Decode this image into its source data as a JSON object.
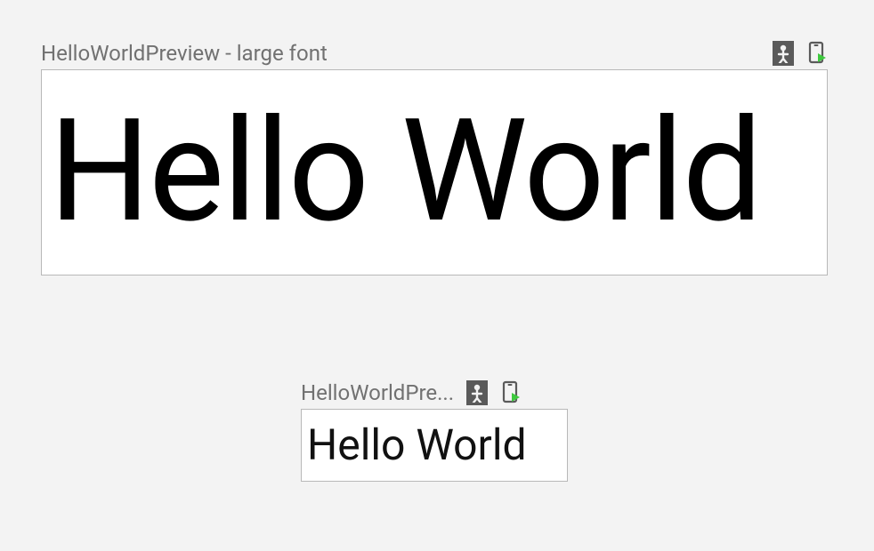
{
  "previews": [
    {
      "title": "HelloWorldPreview - large font",
      "content": "Hello World",
      "icons": {
        "interactive": "interactive-mode-icon",
        "deploy": "deploy-preview-icon"
      }
    },
    {
      "title": "HelloWorldPre...",
      "content": "Hello World",
      "icons": {
        "interactive": "interactive-mode-icon",
        "deploy": "deploy-preview-icon"
      }
    }
  ],
  "colors": {
    "background": "#f3f3f3",
    "title_text": "#717171",
    "canvas_bg": "#ffffff",
    "canvas_border": "#b8b8b8",
    "icon_bg": "#5a5a5a",
    "accent_green": "#3ec93e"
  }
}
